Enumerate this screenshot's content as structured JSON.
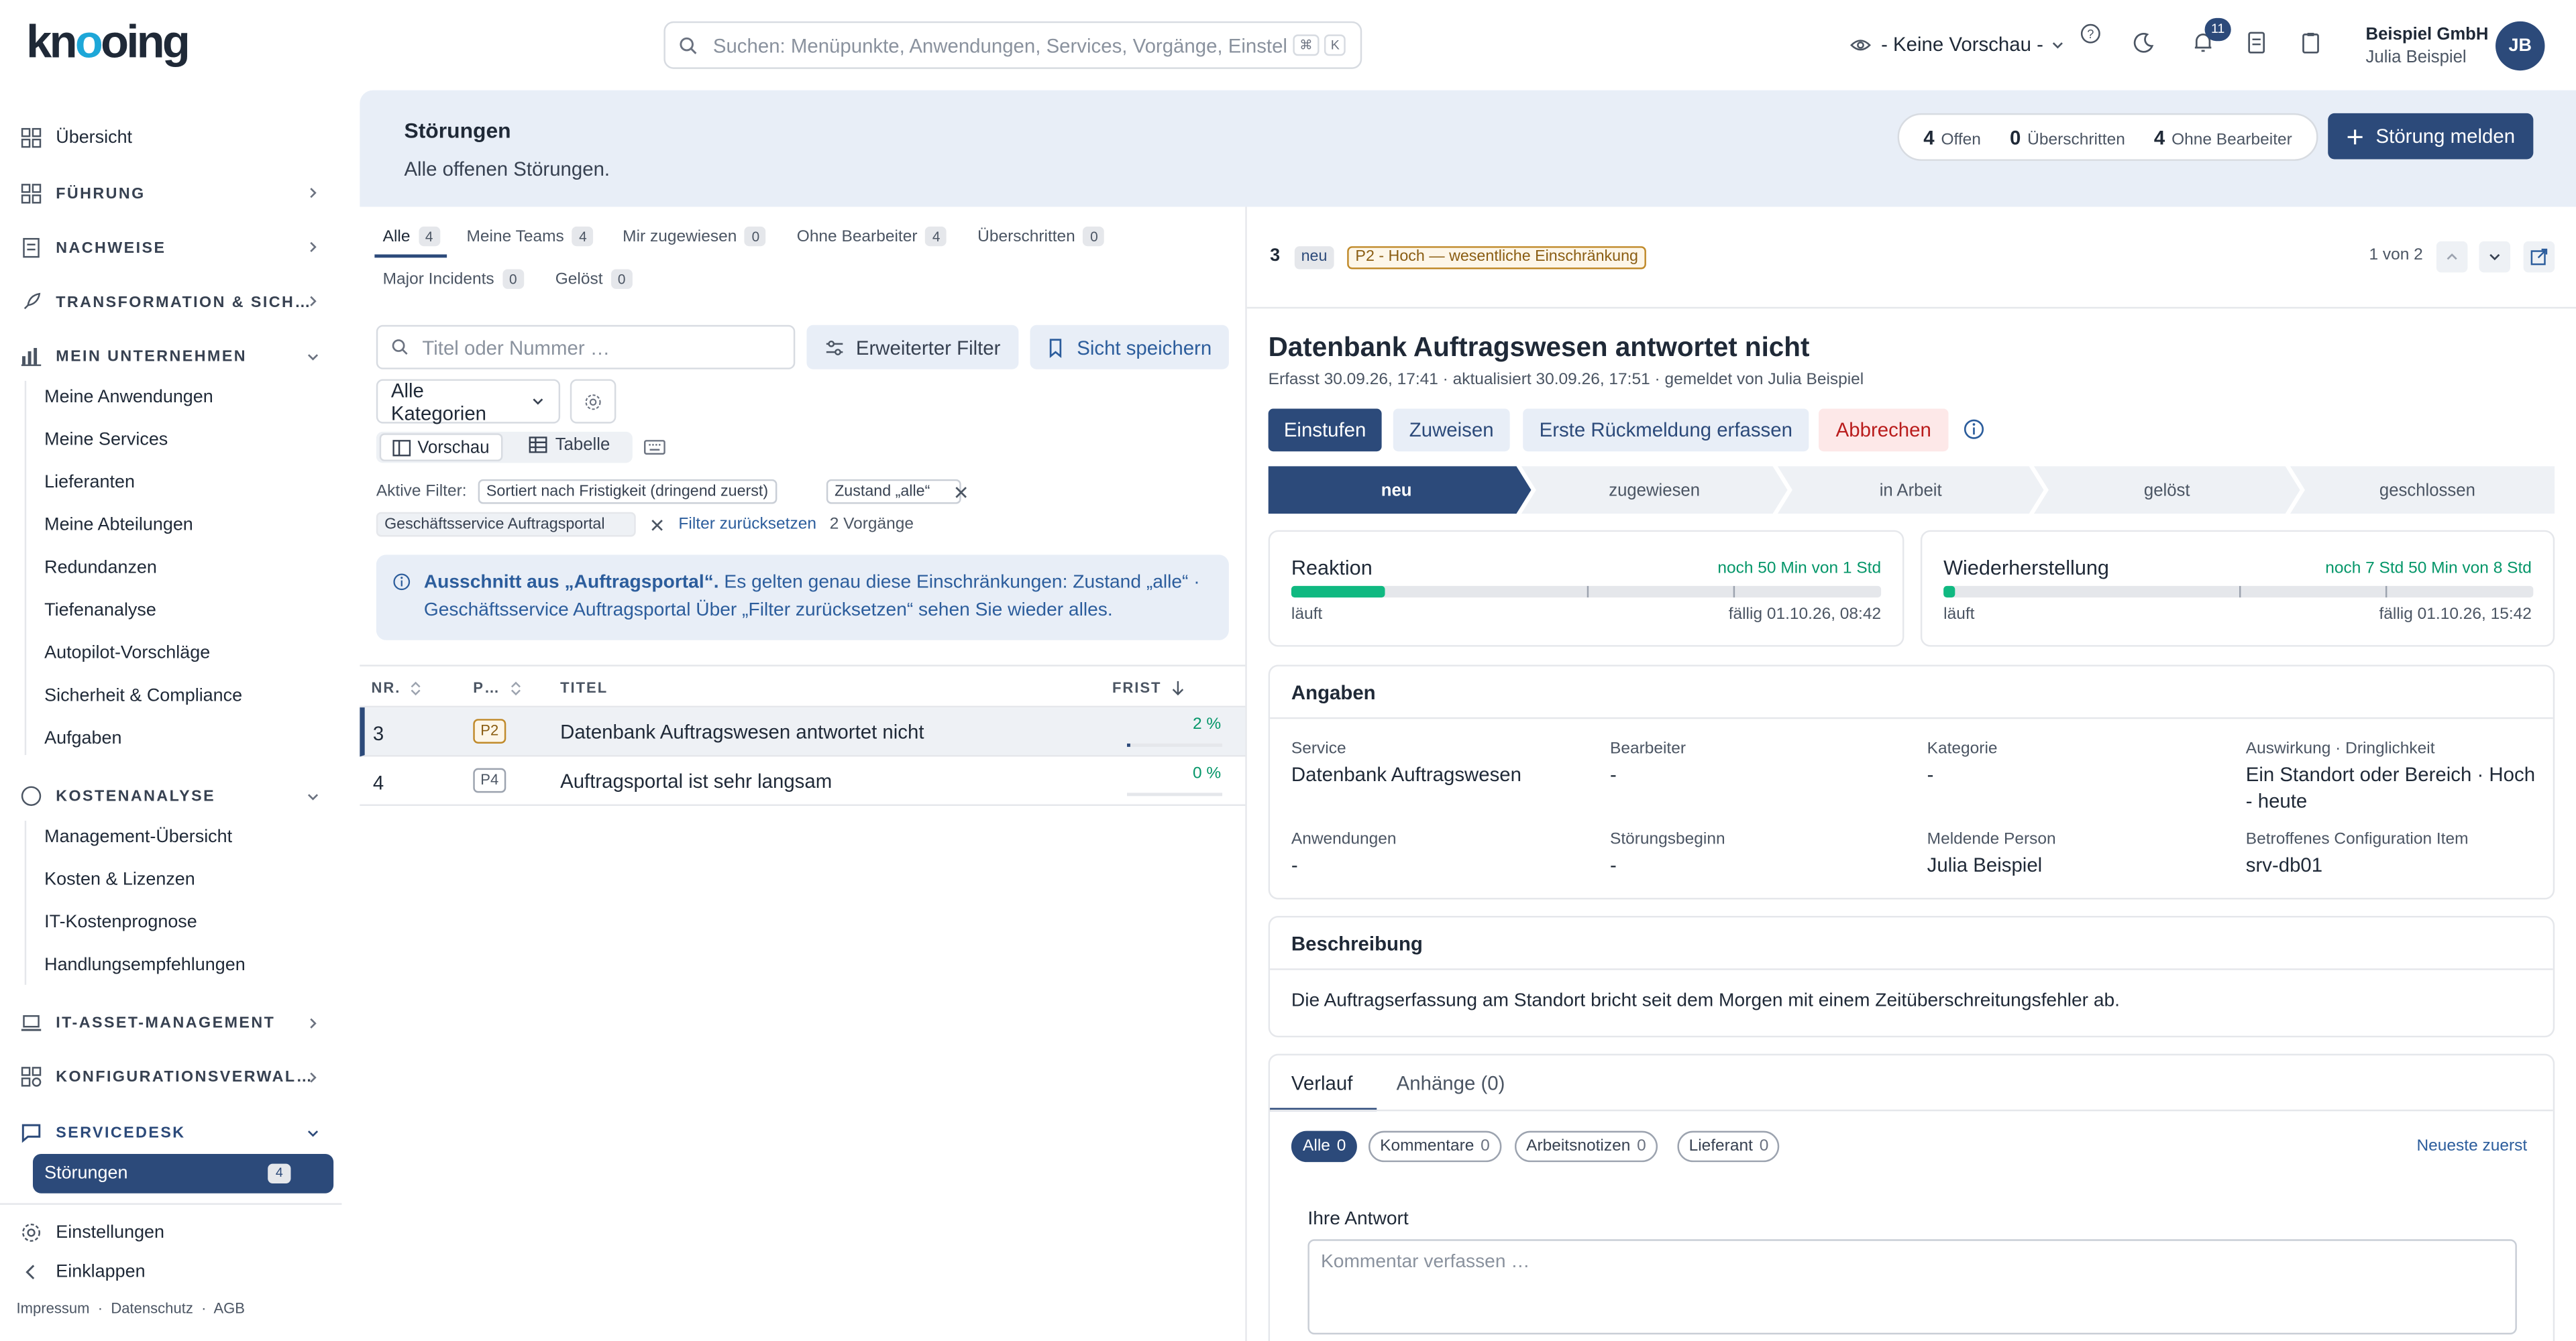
{
  "app": {
    "logo": "knooing"
  },
  "search": {
    "placeholder": "Suchen: Menüpunkte, Anwendungen, Services, Vorgänge, Einstellungen",
    "kbd1": "⌘",
    "kbd2": "K"
  },
  "header": {
    "preview_label": "- Keine Vorschau -",
    "notifications_count": "11",
    "company": "Beispiel GmbH",
    "user": "Julia Beispiel",
    "initials": "JB"
  },
  "sidebar": {
    "overview": "Übersicht",
    "fuehrung": "FÜHRUNG",
    "nachweise": "NACHWEISE",
    "transformation": "TRANSFORMATION & SICH…",
    "unternehmen": "MEIN UNTERNEHMEN",
    "unternehmen_items": [
      "Meine Anwendungen",
      "Meine Services",
      "Lieferanten",
      "Meine Abteilungen",
      "Redundanzen",
      "Tiefenanalyse",
      "Autopilot-Vorschläge",
      "Sicherheit & Compliance",
      "Aufgaben"
    ],
    "kosten": "KOSTENANALYSE",
    "kosten_items": [
      "Management-Übersicht",
      "Kosten & Lizenzen",
      "IT-Kostenprognose",
      "Handlungsempfehlungen"
    ],
    "asset": "IT-ASSET-MANAGEMENT",
    "konfig": "KONFIGURATIONSVERWAL…",
    "servicedesk": "SERVICEDESK",
    "stoerungen": "Störungen",
    "stoerungen_count": "4",
    "settings": "Einstellungen",
    "collapse": "Einklappen",
    "footer": "Impressum  ·  Datenschutz  ·  AGB"
  },
  "page": {
    "title": "Störungen",
    "subtitle": "Alle offenen Störungen.",
    "stats": [
      {
        "n": "4",
        "label": "Offen"
      },
      {
        "n": "0",
        "label": "Überschritten"
      },
      {
        "n": "4",
        "label": "Ohne Bearbeiter"
      }
    ],
    "report_button": "Störung melden"
  },
  "tabs": [
    {
      "label": "Alle",
      "count": "4"
    },
    {
      "label": "Meine Teams",
      "count": "4"
    },
    {
      "label": "Mir zugewiesen",
      "count": "0"
    },
    {
      "label": "Ohne Bearbeiter",
      "count": "4"
    },
    {
      "label": "Überschritten",
      "count": "0"
    },
    {
      "label": "Major Incidents",
      "count": "0"
    },
    {
      "label": "Gelöst",
      "count": "0"
    }
  ],
  "filters": {
    "title_placeholder": "Titel oder Nummer …",
    "advanced": "Erweiterter Filter",
    "save_view": "Sicht speichern",
    "category": "Alle Kategorien",
    "view_preview": "Vorschau",
    "view_table": "Tabelle",
    "active_label": "Aktive Filter:",
    "chip_sort": "Sortiert nach Fristigkeit (dringend zuerst)",
    "chip_state": "Zustand „alle“",
    "chip_service": "Geschäftsservice Auftragsportal",
    "reset": "Filter zurücksetzen",
    "count": "2 Vorgänge"
  },
  "info": {
    "bold": "Ausschnitt aus „Auftragsportal“.",
    "text": " Es gelten genau diese Einschränkungen: Zustand „alle“ · Geschäftsservice Auftragsportal Über „Filter zurücksetzen“ sehen Sie wieder alles."
  },
  "table": {
    "columns": [
      "NR.",
      "P…",
      "TITEL",
      "FRIST"
    ],
    "rows": [
      {
        "nr": "3",
        "prio": "P2",
        "title": "Datenbank Auftragswesen antwortet nicht",
        "frist": "2 %",
        "progress": 0.02
      },
      {
        "nr": "4",
        "prio": "P4",
        "title": "Auftragsportal ist sehr langsam",
        "frist": "0 %",
        "progress": 0
      }
    ]
  },
  "detail": {
    "nr": "3",
    "status": "neu",
    "priority": "P2 - Hoch — wesentliche Einschränkung",
    "pager": "1 von 2",
    "title": "Datenbank Auftragswesen antwortet nicht",
    "meta": "Erfasst 30.09.26, 17:41 · aktualisiert 30.09.26, 17:51 · gemeldet von Julia Beispiel",
    "actions": [
      "Einstufen",
      "Zuweisen",
      "Erste Rückmeldung erfassen",
      "Abbrechen"
    ],
    "steps": [
      "neu",
      "zugewiesen",
      "in Arbeit",
      "gelöst",
      "geschlossen"
    ],
    "sla": [
      {
        "title": "Reaktion",
        "remaining": "noch 50 Min von 1 Std",
        "state": "läuft",
        "due": "fällig 01.10.26, 08:42",
        "progress": 0.16
      },
      {
        "title": "Wiederherstellung",
        "remaining": "noch 7 Std 50 Min von 8 Std",
        "state": "läuft",
        "due": "fällig 01.10.26, 15:42",
        "progress": 0.02
      }
    ],
    "angaben_title": "Angaben",
    "fields": {
      "service_l": "Service",
      "service_v": "Datenbank Auftragswesen",
      "bearbeiter_l": "Bearbeiter",
      "bearbeiter_v": "-",
      "kategorie_l": "Kategorie",
      "kategorie_v": "-",
      "auswirkung_l": "Auswirkung · Dringlichkeit",
      "auswirkung_v": "Ein Standort oder Bereich · Hoch - heute",
      "anwendungen_l": "Anwendungen",
      "anwendungen_v": "-",
      "beginn_l": "Störungsbeginn",
      "beginn_v": "-",
      "melder_l": "Meldende Person",
      "melder_v": "Julia Beispiel",
      "ci_l": "Betroffenes Configuration Item",
      "ci_v": "srv-db01"
    },
    "beschreibung_title": "Beschreibung",
    "beschreibung": "Die Auftragserfassung am Standort bricht seit dem Morgen mit einem Zeitüberschreitungsfehler ab.",
    "history_tabs": [
      "Verlauf",
      "Anhänge (0)"
    ],
    "history_filters": [
      {
        "label": "Alle",
        "n": "0"
      },
      {
        "label": "Kommentare",
        "n": "0"
      },
      {
        "label": "Arbeitsnotizen",
        "n": "0"
      },
      {
        "label": "Lieferant",
        "n": "0"
      }
    ],
    "sort": "Neueste zuerst",
    "reply_label": "Ihre Antwort",
    "reply_placeholder": "Kommentar verfassen …"
  },
  "colors": {
    "primary": "#2c4a7a",
    "accent": "#1ea7d8",
    "green": "#10b981",
    "danger": "#b91c1c",
    "warning": "#c08a2a"
  }
}
